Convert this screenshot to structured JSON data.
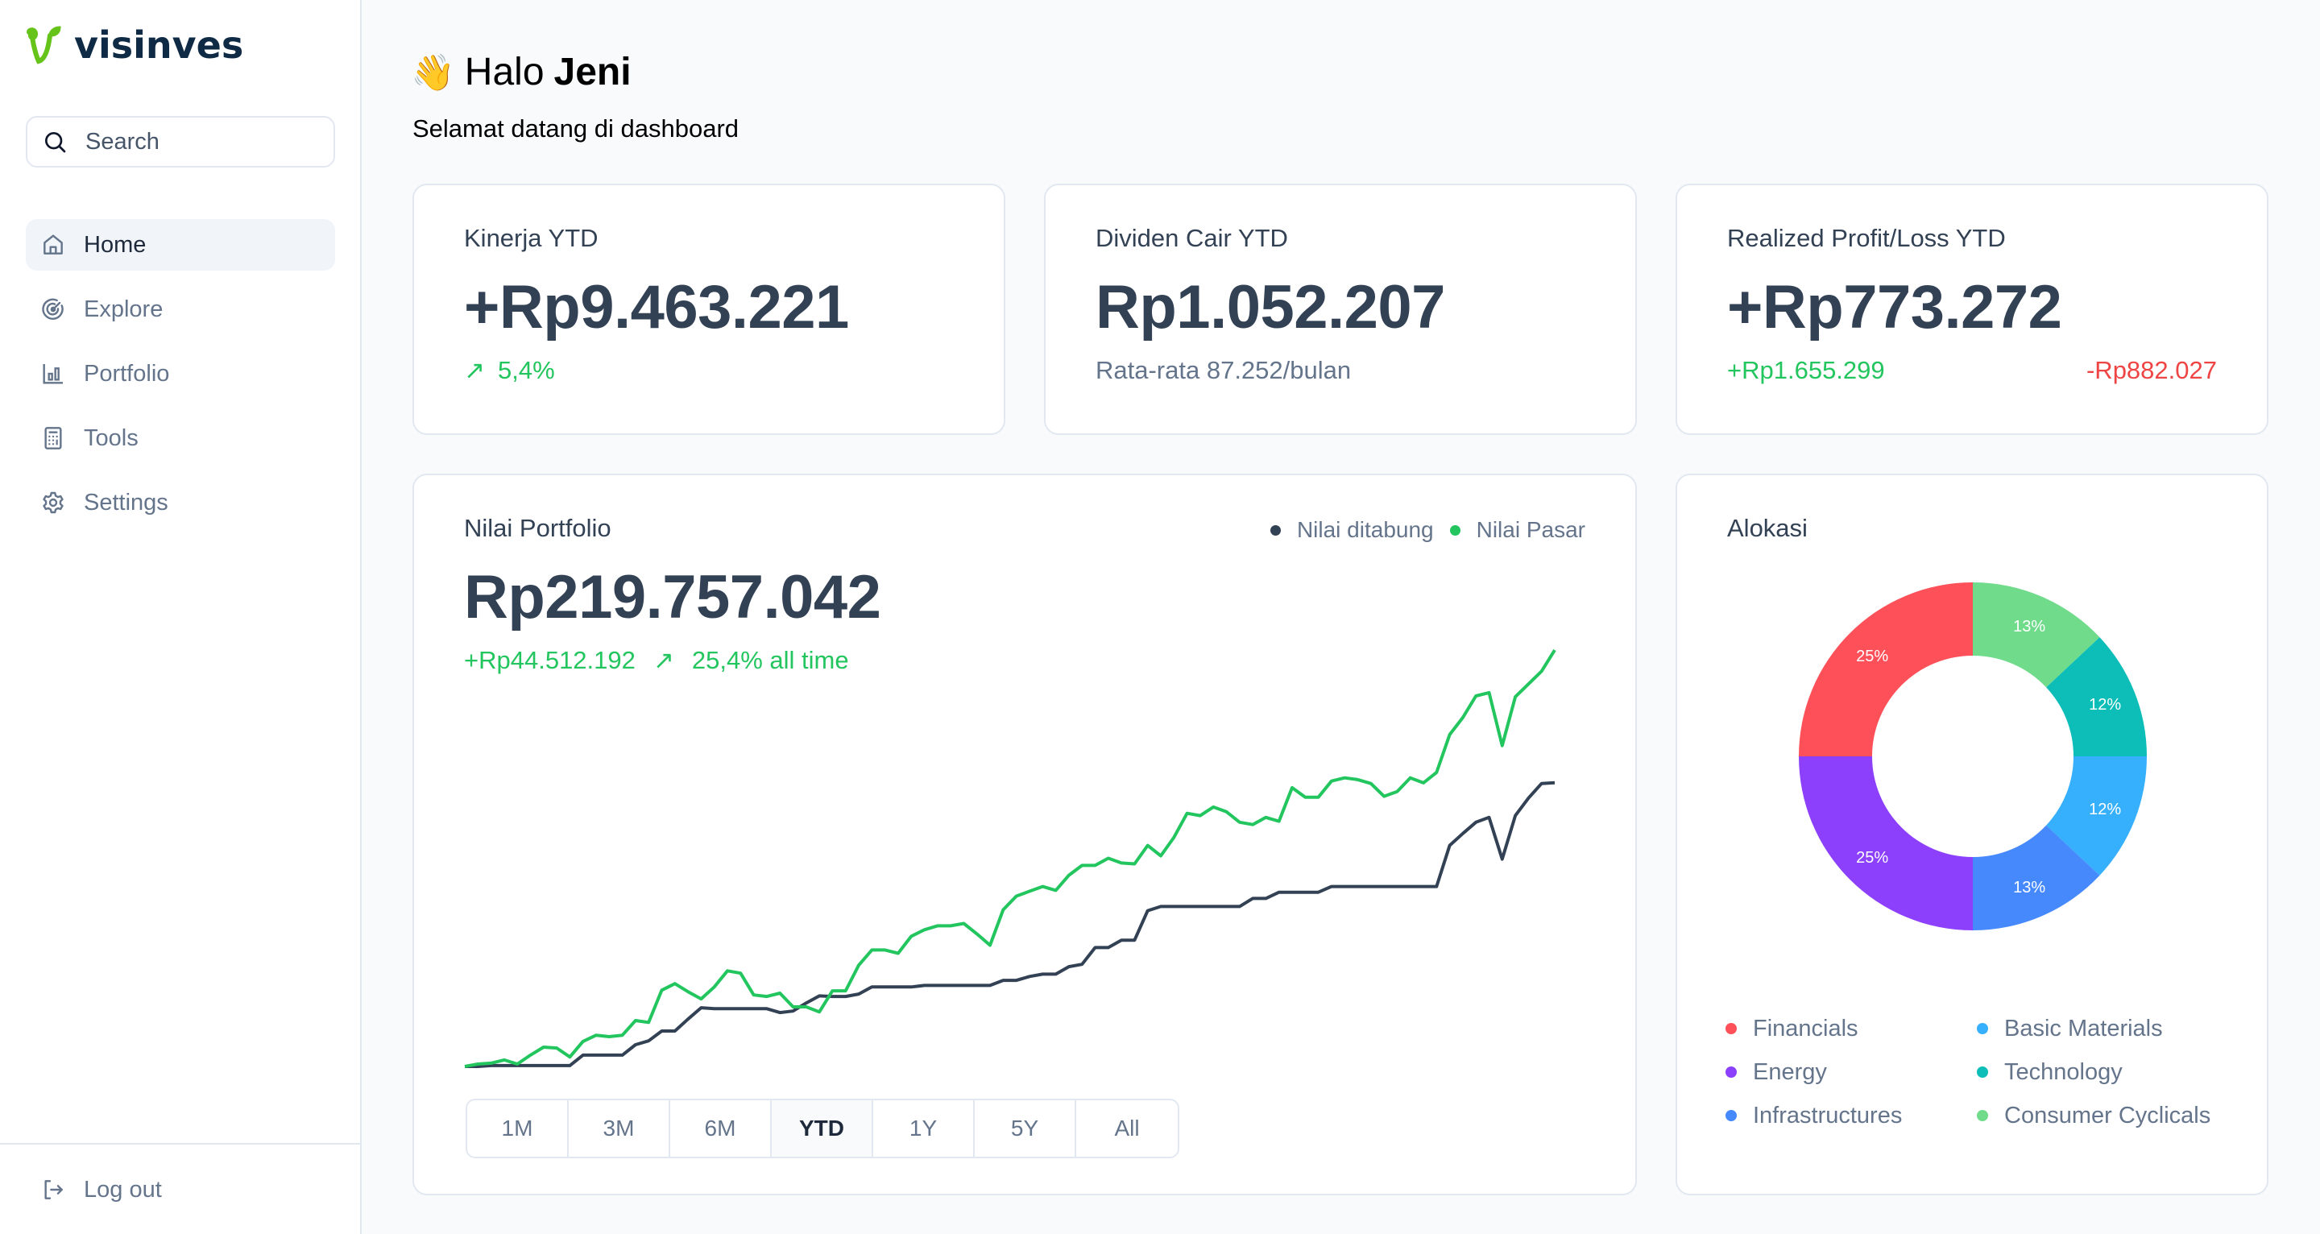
{
  "brand": {
    "name": "visinves",
    "logo_icon": "sprout-icon",
    "logo_color": "#65c31a",
    "text_color": "#0f2a44"
  },
  "search": {
    "placeholder": "Search",
    "value": ""
  },
  "sidebar": {
    "items": [
      {
        "label": "Home",
        "icon": "home-icon",
        "active": true
      },
      {
        "label": "Explore",
        "icon": "radar-icon",
        "active": false
      },
      {
        "label": "Portfolio",
        "icon": "bar-chart-icon",
        "active": false
      },
      {
        "label": "Tools",
        "icon": "calculator-icon",
        "active": false
      },
      {
        "label": "Settings",
        "icon": "gear-icon",
        "active": false
      }
    ],
    "logout": {
      "label": "Log out",
      "icon": "logout-icon"
    }
  },
  "greeting": {
    "emoji": "👋",
    "prefix": "Halo",
    "name": "Jeni",
    "subtitle": "Selamat datang di dashboard"
  },
  "cards": {
    "kinerja": {
      "title": "Kinerja YTD",
      "value": "+Rp9.463.221",
      "change_arrow": "↗",
      "change": "5,4%"
    },
    "dividen": {
      "title": "Dividen Cair YTD",
      "value": "Rp1.052.207",
      "sub": "Rata-rata 87.252/bulan"
    },
    "realized": {
      "title": "Realized Profit/Loss YTD",
      "value": "+Rp773.272",
      "profit": "+Rp1.655.299",
      "loss": "-Rp882.027"
    }
  },
  "portfolio": {
    "title": "Nilai Portfolio",
    "value": "Rp219.757.042",
    "gain": "+Rp44.512.192",
    "gain_arrow": "↗",
    "gain_pct": "25,4% all time",
    "ranges": [
      "1M",
      "3M",
      "6M",
      "YTD",
      "1Y",
      "5Y",
      "All"
    ],
    "active_range": "YTD"
  },
  "alokasi": {
    "title": "Alokasi"
  },
  "colors": {
    "positive": "#22c55e",
    "negative": "#ef4444",
    "text_dark": "#334155",
    "text_muted": "#64748b",
    "border": "#e2e8f0"
  },
  "chart_data": [
    {
      "type": "line",
      "title": "Nilai Portfolio",
      "xlabel": "",
      "ylabel": "",
      "unit": "Rp (juta), estimated — no axis labels shown",
      "grid": false,
      "legend": "top-right",
      "ylim": [
        80,
        219.8
      ],
      "series": [
        {
          "name": "Nilai ditabung",
          "color": "#334155",
          "values": [
            80.0,
            80.0,
            80.3,
            80.3,
            80.3,
            80.3,
            80.3,
            80.3,
            80.3,
            83.8,
            83.8,
            83.8,
            83.8,
            87.3,
            88.6,
            91.9,
            91.9,
            95.9,
            99.7,
            99.4,
            99.4,
            99.4,
            99.4,
            99.4,
            98.1,
            98.6,
            101.3,
            103.7,
            103.5,
            103.5,
            104.3,
            106.7,
            106.7,
            106.7,
            106.7,
            107.2,
            107.2,
            107.2,
            107.2,
            107.2,
            107.2,
            108.9,
            108.9,
            110.2,
            111.0,
            111.0,
            113.5,
            114.3,
            119.9,
            119.9,
            122.4,
            122.4,
            132.3,
            133.7,
            133.7,
            133.7,
            133.7,
            133.7,
            133.7,
            133.7,
            136.4,
            136.4,
            138.5,
            138.5,
            138.5,
            138.5,
            140.4,
            140.4,
            140.4,
            140.4,
            140.4,
            140.4,
            140.4,
            140.4,
            140.4,
            154.2,
            158.2,
            162.0,
            163.6,
            149.6,
            164.2,
            170.1,
            175.0,
            175.24
          ]
        },
        {
          "name": "Nilai Pasar",
          "color": "#22c55e",
          "values": [
            80.0,
            80.8,
            81.1,
            82.2,
            80.8,
            83.8,
            86.5,
            86.2,
            83.2,
            88.4,
            90.5,
            90.0,
            90.5,
            95.4,
            94.8,
            105.6,
            107.8,
            105.1,
            102.7,
            106.7,
            112.1,
            111.3,
            104.0,
            103.5,
            104.6,
            100.0,
            100.0,
            98.3,
            105.4,
            105.4,
            114.0,
            119.1,
            119.1,
            118.0,
            123.7,
            125.9,
            127.2,
            127.2,
            128.0,
            124.5,
            120.7,
            132.6,
            137.2,
            138.8,
            140.4,
            139.1,
            144.2,
            147.5,
            147.5,
            149.9,
            148.3,
            148.0,
            154.2,
            150.7,
            156.9,
            165.0,
            164.2,
            167.1,
            165.5,
            162.0,
            161.2,
            163.6,
            162.3,
            173.6,
            170.4,
            170.4,
            175.8,
            176.9,
            176.3,
            175.0,
            170.7,
            172.3,
            176.9,
            175.2,
            178.7,
            191.4,
            197.1,
            204.4,
            205.5,
            187.7,
            204.1,
            208.4,
            212.7,
            219.76
          ]
        }
      ]
    },
    {
      "type": "pie",
      "title": "Alokasi",
      "donut": true,
      "legend": "bottom",
      "slices": [
        {
          "label": "Consumer Cyclicals",
          "value": 13,
          "display": "13%",
          "color": "#6fdb8b"
        },
        {
          "label": "Technology",
          "value": 12,
          "display": "12%",
          "color": "#0cbdb8"
        },
        {
          "label": "Basic Materials",
          "value": 12,
          "display": "12%",
          "color": "#36b0fd"
        },
        {
          "label": "Infrastructures",
          "value": 13,
          "display": "13%",
          "color": "#4589fd"
        },
        {
          "label": "Energy",
          "value": 25,
          "display": "25%",
          "color": "#8c40fc"
        },
        {
          "label": "Financials",
          "value": 25,
          "display": "25%",
          "color": "#fd5059"
        }
      ],
      "legend_order": [
        "Financials",
        "Energy",
        "Infrastructures",
        "Basic Materials",
        "Technology",
        "Consumer Cyclicals"
      ]
    }
  ]
}
